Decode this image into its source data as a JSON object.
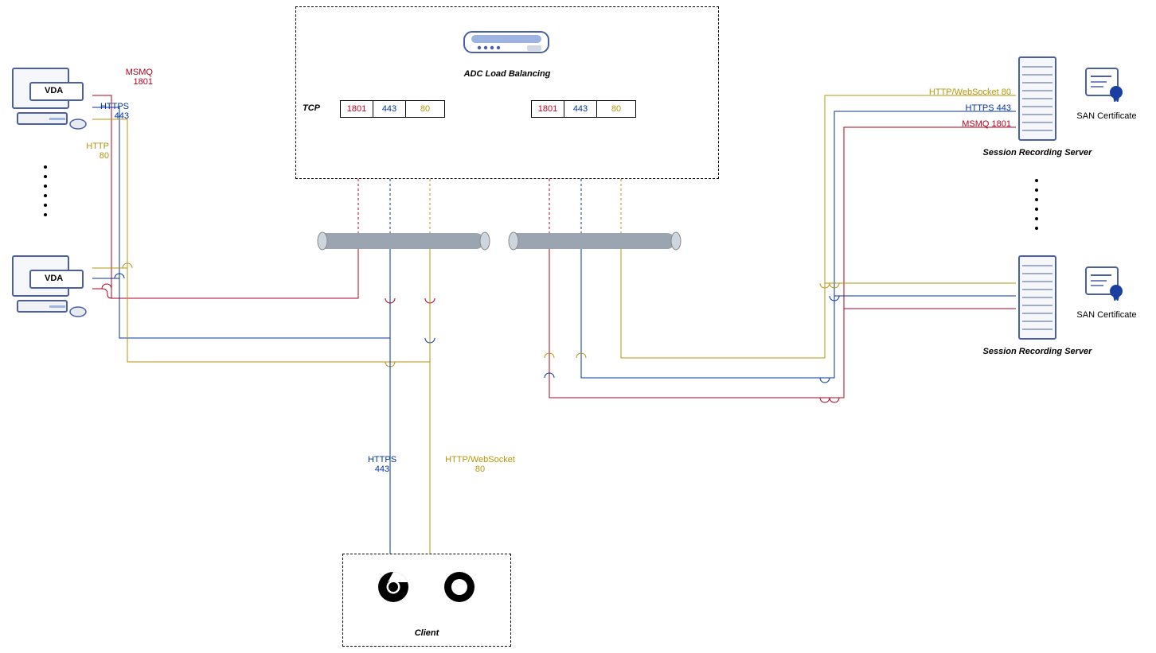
{
  "adc": {
    "title": "ADC Load Balancing",
    "tcp_label": "TCP",
    "ports": {
      "msmq": "1801",
      "https": "443",
      "http": "80"
    }
  },
  "vda": {
    "label": "VDA",
    "msmq_label": "MSMQ",
    "msmq_port": "1801",
    "https_label": "HTTPS",
    "https_port": "443",
    "http_label": "HTTP",
    "http_port": "80"
  },
  "client": {
    "title": "Client",
    "https_label": "HTTPS",
    "https_port": "443",
    "http_label": "HTTP/WebSocket",
    "http_port": "80"
  },
  "server": {
    "title": "Session Recording Server",
    "cert_label": "SAN Certificate",
    "http_label": "HTTP/WebSocket  80",
    "https_label": "HTTPS  443",
    "msmq_label": "MSMQ  1801"
  }
}
